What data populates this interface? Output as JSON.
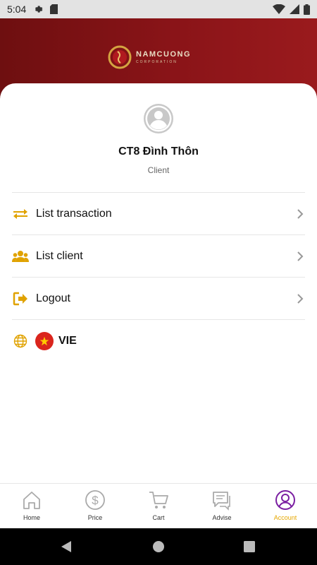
{
  "status_bar": {
    "time": "5:04"
  },
  "brand": {
    "name": "NAMCUONG",
    "tagline": "CORPORATION"
  },
  "profile": {
    "name": "CT8 Đình Thôn",
    "role": "Client"
  },
  "menu": [
    {
      "label": "List transaction",
      "icon": "transfer-icon"
    },
    {
      "label": "List client",
      "icon": "users-icon"
    },
    {
      "label": "Logout",
      "icon": "logout-icon"
    }
  ],
  "language": {
    "label": "VIE",
    "icon": "globe-icon",
    "flag": "vietnam-flag"
  },
  "nav": [
    {
      "label": "Home",
      "icon": "home-icon"
    },
    {
      "label": "Price",
      "icon": "dollar-icon"
    },
    {
      "label": "Cart",
      "icon": "cart-icon"
    },
    {
      "label": "Advise",
      "icon": "chat-icon"
    },
    {
      "label": "Account",
      "icon": "account-icon",
      "active": true
    }
  ],
  "colors": {
    "accent": "#e6a700",
    "header": "#8a1418",
    "active_icon": "#7b1fa2",
    "flag": "#da251d"
  }
}
